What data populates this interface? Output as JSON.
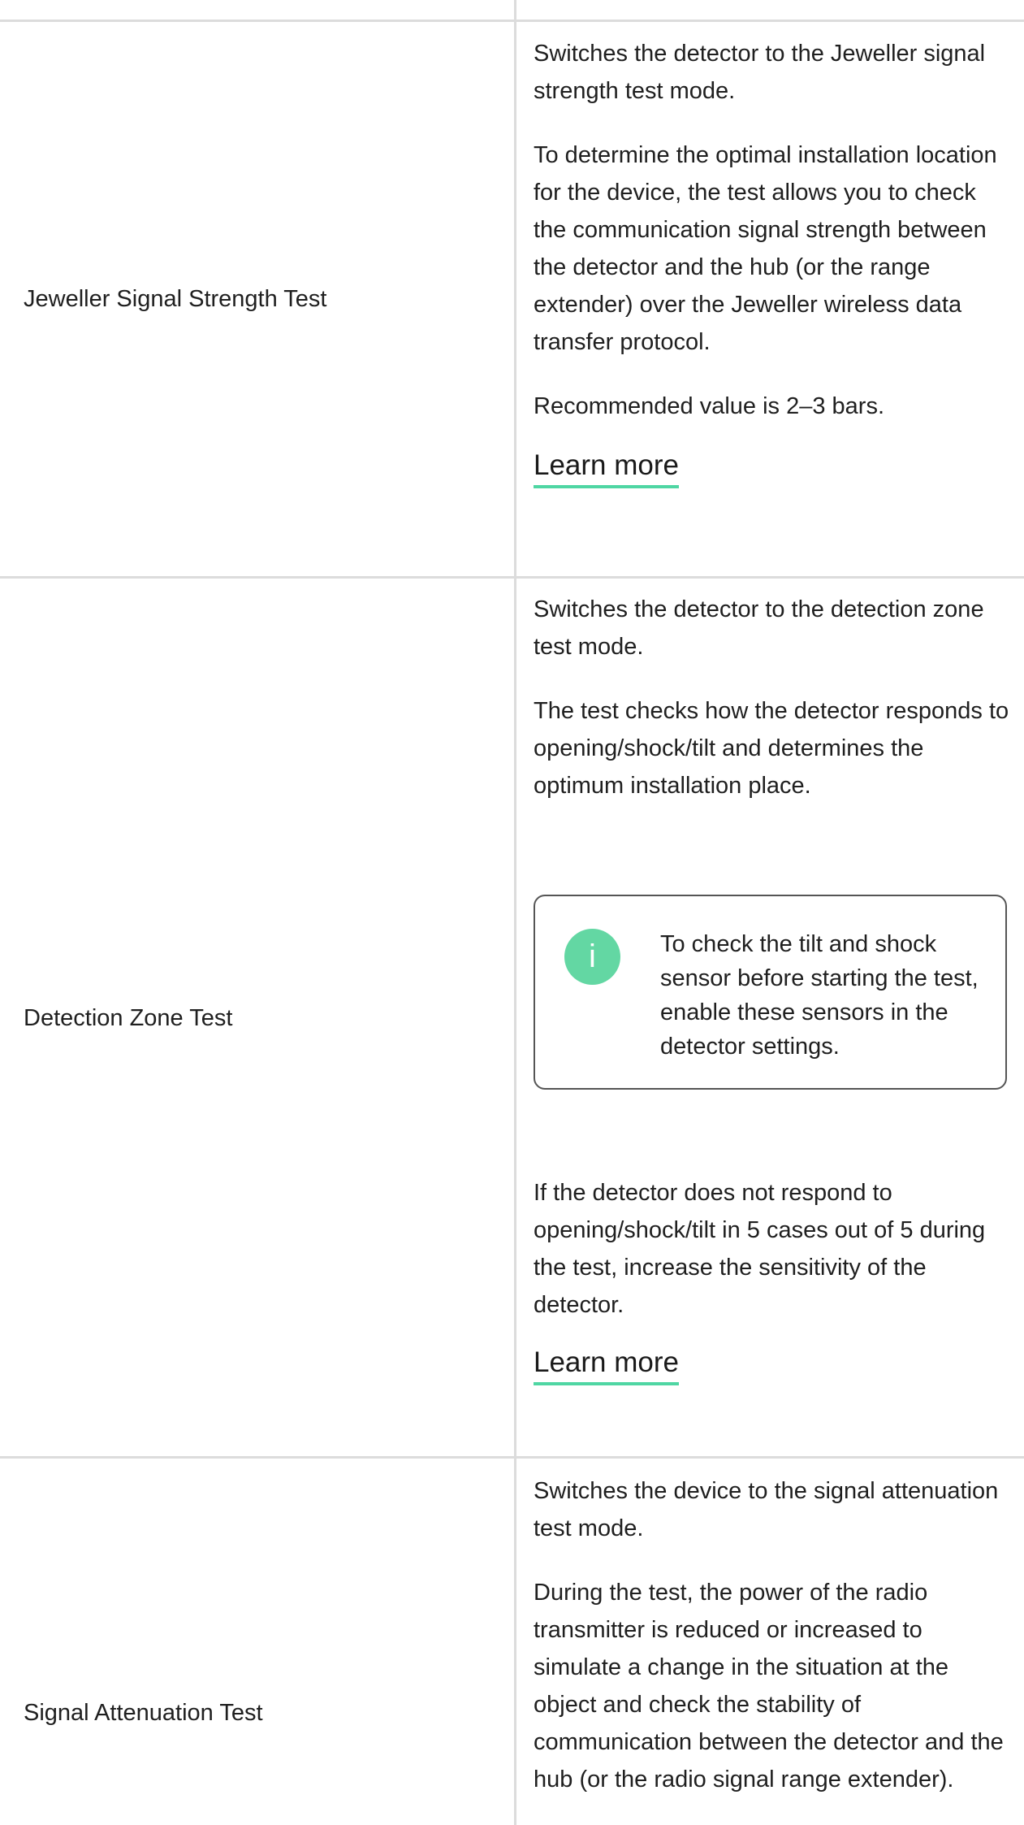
{
  "rows": [
    {
      "name": "Jeweller Signal Strength Test",
      "paragraphs": [
        "Switches the detector to the Jeweller signal strength test mode.",
        "To determine the optimal installation location for the device, the test allows you to check the communication signal strength between the detector and the hub (or the range extender) over the Jeweller wireless data transfer protocol.",
        "Recommended value is 2–3 bars."
      ],
      "link": "Learn more"
    },
    {
      "name": "Detection Zone Test",
      "paragraphs": [
        "Switches the detector to the detection zone test mode.",
        "The test checks how the detector responds to opening/shock/tilt and determines the optimum installation place."
      ],
      "note": "To check the tilt and shock sensor before starting the test, enable these sensors in the detector settings.",
      "note_icon": "info-icon",
      "after_note": "If the detector does not respond to opening/shock/tilt in 5 cases out of 5 during the test, increase the sensitivity of the detector.",
      "link": "Learn more"
    },
    {
      "name": "Signal Attenuation Test",
      "paragraphs": [
        "Switches the device to the signal attenuation test mode.",
        "During the test, the power of the radio transmitter is reduced or increased to simulate a change in the situation at the object and check the stability of communication between the detector and the hub (or the radio signal range extender)."
      ]
    }
  ],
  "colors": {
    "accent": "#4fd6a3",
    "divider": "#dcdcdc",
    "text": "#1f1f1f"
  }
}
